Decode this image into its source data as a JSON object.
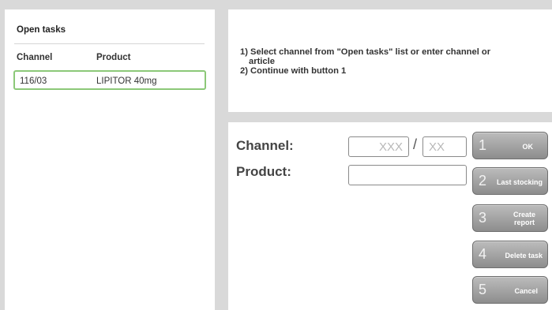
{
  "open_tasks": {
    "title": "Open tasks",
    "columns": [
      "Channel",
      "Product"
    ],
    "rows": [
      {
        "channel": "116/03",
        "product": "LIPITOR 40mg"
      }
    ]
  },
  "instructions": {
    "line1": "1) Select channel from \"Open tasks\" list or enter channel or",
    "line1b": "article",
    "line2": "2) Continue with button 1"
  },
  "form": {
    "channel_label": "Channel:",
    "product_label": "Product:",
    "channel_a_placeholder": "XXX",
    "channel_b_placeholder": "XX",
    "separator": "/",
    "product_value": ""
  },
  "buttons": [
    {
      "num": "1",
      "label": "OK"
    },
    {
      "num": "2",
      "label": "Last stocking"
    },
    {
      "num": "3",
      "label": "Create report"
    },
    {
      "num": "4",
      "label": "Delete task"
    },
    {
      "num": "5",
      "label": "Cancel"
    }
  ],
  "colors": {
    "row_selected_border": "#8cc878",
    "button_gradient_top": "#bcbcbc",
    "button_gradient_bottom": "#8d8d8d",
    "background": "#d9d9d9"
  }
}
